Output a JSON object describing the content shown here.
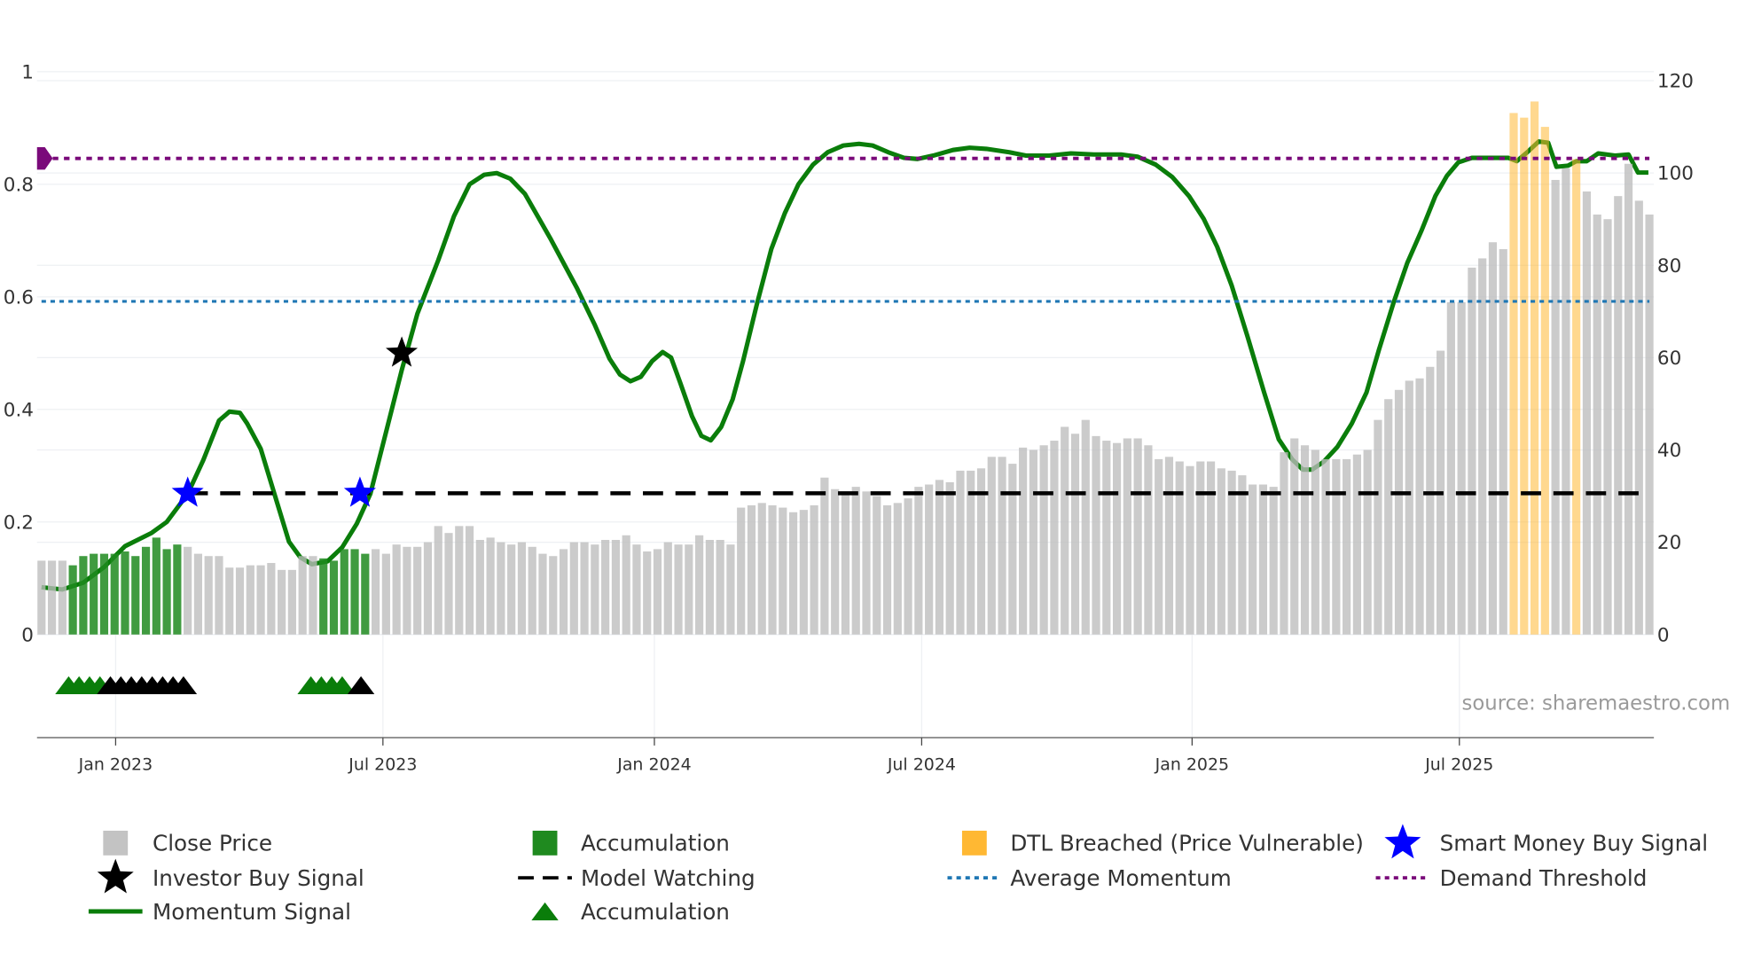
{
  "chart_data": {
    "type": "bar+line",
    "source": "source: sharemaestro.com",
    "left_axis": {
      "range": [
        0,
        1
      ],
      "ticks": [
        {
          "v": 0,
          "label": "0"
        },
        {
          "v": 0.2,
          "label": "0.2"
        },
        {
          "v": 0.4,
          "label": "0.4"
        },
        {
          "v": 0.6,
          "label": "0.6"
        },
        {
          "v": 0.8,
          "label": "0.8"
        },
        {
          "v": 1,
          "label": "1"
        }
      ]
    },
    "right_axis": {
      "range": [
        0,
        120
      ],
      "ticks": [
        {
          "v": 0,
          "label": "0"
        },
        {
          "v": 20,
          "label": "20"
        },
        {
          "v": 40,
          "label": "40"
        },
        {
          "v": 60,
          "label": "60"
        },
        {
          "v": 80,
          "label": "80"
        },
        {
          "v": 100,
          "label": "100"
        },
        {
          "v": 120,
          "label": "120"
        }
      ]
    },
    "x_axis": {
      "unit": "week_index",
      "range": [
        0,
        154
      ],
      "ticks": [
        {
          "at": 7.1,
          "label": "Jan 2023"
        },
        {
          "at": 32.7,
          "label": "Jul 2023"
        },
        {
          "at": 58.7,
          "label": "Jan 2024"
        },
        {
          "at": 84.3,
          "label": "Jul 2024"
        },
        {
          "at": 110.2,
          "label": "Jan 2025"
        },
        {
          "at": 135.8,
          "label": "Jul 2025"
        }
      ]
    },
    "close_price": [
      16,
      16,
      16,
      15,
      17,
      17.5,
      17.5,
      17.5,
      18,
      17,
      19,
      21,
      18.5,
      19.5,
      19,
      17.5,
      17,
      17,
      14.5,
      14.5,
      15,
      15,
      15.5,
      14,
      14,
      17,
      17,
      16.5,
      16,
      18.5,
      18.5,
      17.5,
      18.5,
      17.5,
      19.5,
      19,
      19,
      20,
      23.5,
      22,
      23.5,
      23.5,
      20.5,
      21,
      20,
      19.5,
      20,
      19,
      17.5,
      17,
      18.5,
      20,
      20,
      19.5,
      20.5,
      20.5,
      21.5,
      19.5,
      18,
      18.5,
      20,
      19.5,
      19.5,
      21.5,
      20.5,
      20.5,
      19.5,
      27.5,
      28,
      28.5,
      28,
      27.5,
      26.5,
      27,
      28,
      34,
      31.5,
      31,
      32,
      31,
      30,
      28,
      28.5,
      29.5,
      32,
      32.5,
      33.5,
      33,
      35.5,
      35.5,
      36,
      38.5,
      38.5,
      37,
      40.5,
      40,
      41,
      42,
      45,
      43.5,
      46.5,
      43,
      42,
      41.5,
      42.5,
      42.5,
      41,
      38,
      38.5,
      37.5,
      36.5,
      37.5,
      37.5,
      36,
      35.5,
      34.5,
      32.5,
      32.5,
      32,
      39.5,
      42.5,
      41,
      40,
      38,
      38,
      38,
      39,
      40,
      46.5,
      51,
      53,
      55,
      55.5,
      58,
      61.5,
      72,
      72,
      79.5,
      81.5,
      85,
      83.5,
      113,
      112,
      115.5,
      110,
      98.5,
      101,
      103,
      96,
      91,
      90,
      95,
      102,
      94,
      91
    ],
    "accumulation_bars": [
      [
        3,
        13
      ],
      [
        27,
        31
      ]
    ],
    "dtl_breached_bars": [
      141,
      142,
      143,
      144,
      147
    ],
    "momentum": [
      [
        0,
        0.084
      ],
      [
        2,
        0.08
      ],
      [
        4,
        0.092
      ],
      [
        6,
        0.12
      ],
      [
        8,
        0.157
      ],
      [
        10.5,
        0.18
      ],
      [
        12,
        0.2
      ],
      [
        14,
        0.25
      ],
      [
        15.5,
        0.31
      ],
      [
        17,
        0.38
      ],
      [
        18,
        0.396
      ],
      [
        19,
        0.394
      ],
      [
        19.7,
        0.375
      ],
      [
        21,
        0.33
      ],
      [
        22.3,
        0.25
      ],
      [
        23.7,
        0.165
      ],
      [
        24.8,
        0.137
      ],
      [
        25.9,
        0.125
      ],
      [
        27.4,
        0.13
      ],
      [
        28.8,
        0.155
      ],
      [
        30.2,
        0.197
      ],
      [
        31.5,
        0.25
      ],
      [
        33,
        0.36
      ],
      [
        34.5,
        0.47
      ],
      [
        36,
        0.57
      ],
      [
        38,
        0.665
      ],
      [
        39.5,
        0.743
      ],
      [
        41,
        0.8
      ],
      [
        42.4,
        0.817
      ],
      [
        43.6,
        0.82
      ],
      [
        44.9,
        0.81
      ],
      [
        46.3,
        0.783
      ],
      [
        48.7,
        0.705
      ],
      [
        51.3,
        0.615
      ],
      [
        53,
        0.55
      ],
      [
        54.4,
        0.49
      ],
      [
        55.4,
        0.462
      ],
      [
        56.4,
        0.45
      ],
      [
        57.4,
        0.458
      ],
      [
        58.5,
        0.486
      ],
      [
        59.5,
        0.502
      ],
      [
        60.3,
        0.492
      ],
      [
        61.2,
        0.446
      ],
      [
        62.3,
        0.388
      ],
      [
        63.2,
        0.353
      ],
      [
        64.1,
        0.345
      ],
      [
        65.1,
        0.369
      ],
      [
        66.2,
        0.418
      ],
      [
        67.2,
        0.486
      ],
      [
        68.5,
        0.586
      ],
      [
        69.9,
        0.685
      ],
      [
        71.2,
        0.749
      ],
      [
        72.5,
        0.8
      ],
      [
        73.9,
        0.835
      ],
      [
        75.3,
        0.857
      ],
      [
        76.8,
        0.869
      ],
      [
        78.3,
        0.872
      ],
      [
        79.6,
        0.869
      ],
      [
        81.1,
        0.857
      ],
      [
        82.6,
        0.847
      ],
      [
        83.9,
        0.845
      ],
      [
        85.4,
        0.851
      ],
      [
        87.3,
        0.861
      ],
      [
        88.9,
        0.865
      ],
      [
        90.5,
        0.863
      ],
      [
        92.7,
        0.857
      ],
      [
        94.3,
        0.851
      ],
      [
        96.5,
        0.851
      ],
      [
        98.6,
        0.855
      ],
      [
        100.8,
        0.853
      ],
      [
        103.4,
        0.853
      ],
      [
        105,
        0.849
      ],
      [
        106.7,
        0.835
      ],
      [
        108.3,
        0.813
      ],
      [
        109.9,
        0.779
      ],
      [
        111.3,
        0.739
      ],
      [
        112.6,
        0.689
      ],
      [
        114,
        0.62
      ],
      [
        115.5,
        0.53
      ],
      [
        117.1,
        0.43
      ],
      [
        118.5,
        0.347
      ],
      [
        119.8,
        0.311
      ],
      [
        120.8,
        0.293
      ],
      [
        121.7,
        0.293
      ],
      [
        122.8,
        0.307
      ],
      [
        124.1,
        0.333
      ],
      [
        125.5,
        0.375
      ],
      [
        126.9,
        0.43
      ],
      [
        128.1,
        0.506
      ],
      [
        129.5,
        0.59
      ],
      [
        130.8,
        0.66
      ],
      [
        132.2,
        0.719
      ],
      [
        133.5,
        0.779
      ],
      [
        134.6,
        0.815
      ],
      [
        135.7,
        0.839
      ],
      [
        137,
        0.847
      ],
      [
        140.5,
        0.847
      ],
      [
        141.3,
        0.841
      ],
      [
        142.3,
        0.857
      ],
      [
        143.4,
        0.876
      ],
      [
        144.3,
        0.874
      ],
      [
        145.1,
        0.831
      ],
      [
        146.2,
        0.833
      ],
      [
        147,
        0.841
      ],
      [
        148,
        0.841
      ],
      [
        149.1,
        0.855
      ],
      [
        150.7,
        0.851
      ],
      [
        152,
        0.853
      ],
      [
        152.9,
        0.821
      ],
      [
        153.9,
        0.821
      ]
    ],
    "demand_threshold": 0.846,
    "average_momentum": 0.592,
    "model_watching": {
      "value": 0.251,
      "from": 14,
      "to": 154
    },
    "smart_money_buy_signals": [
      [
        14,
        0.251
      ],
      [
        30.5,
        0.251
      ]
    ],
    "investor_buy_signals": [
      [
        34.5,
        0.5
      ]
    ],
    "accumulation_markers": {
      "level": -0.09,
      "green": [
        2.6,
        3.6,
        4.6,
        5.6
      ],
      "black": [
        6.6,
        7.6,
        8.6,
        9.6,
        10.6,
        11.6,
        12.6,
        13.6
      ],
      "green2": [
        25.8,
        26.8,
        27.8,
        28.8
      ],
      "black2": [
        30.6
      ]
    },
    "colors": {
      "price": "#bdbdbd",
      "accumulation": "#1f8a1f",
      "dtl": "#ffb833",
      "momentum": "#0a7d0a",
      "avg": "#1f77b4",
      "demand": "#7a0a7a",
      "star_blue": "#0000ff"
    },
    "legend": [
      {
        "label": "Close Price",
        "symbol": "square-grey"
      },
      {
        "label": "Accumulation",
        "symbol": "square-green"
      },
      {
        "label": "DTL Breached (Price Vulnerable)",
        "symbol": "square-orange"
      },
      {
        "label": "Smart Money Buy Signal",
        "symbol": "star-blue"
      },
      {
        "label": "Investor Buy Signal",
        "symbol": "star-black"
      },
      {
        "label": "Model Watching",
        "symbol": "dash-black"
      },
      {
        "label": "Average Momentum",
        "symbol": "dot-blue"
      },
      {
        "label": "Demand Threshold",
        "symbol": "dot-purple"
      },
      {
        "label": "Momentum Signal",
        "symbol": "line-green"
      },
      {
        "label": "Accumulation",
        "symbol": "triangle-green"
      }
    ]
  }
}
